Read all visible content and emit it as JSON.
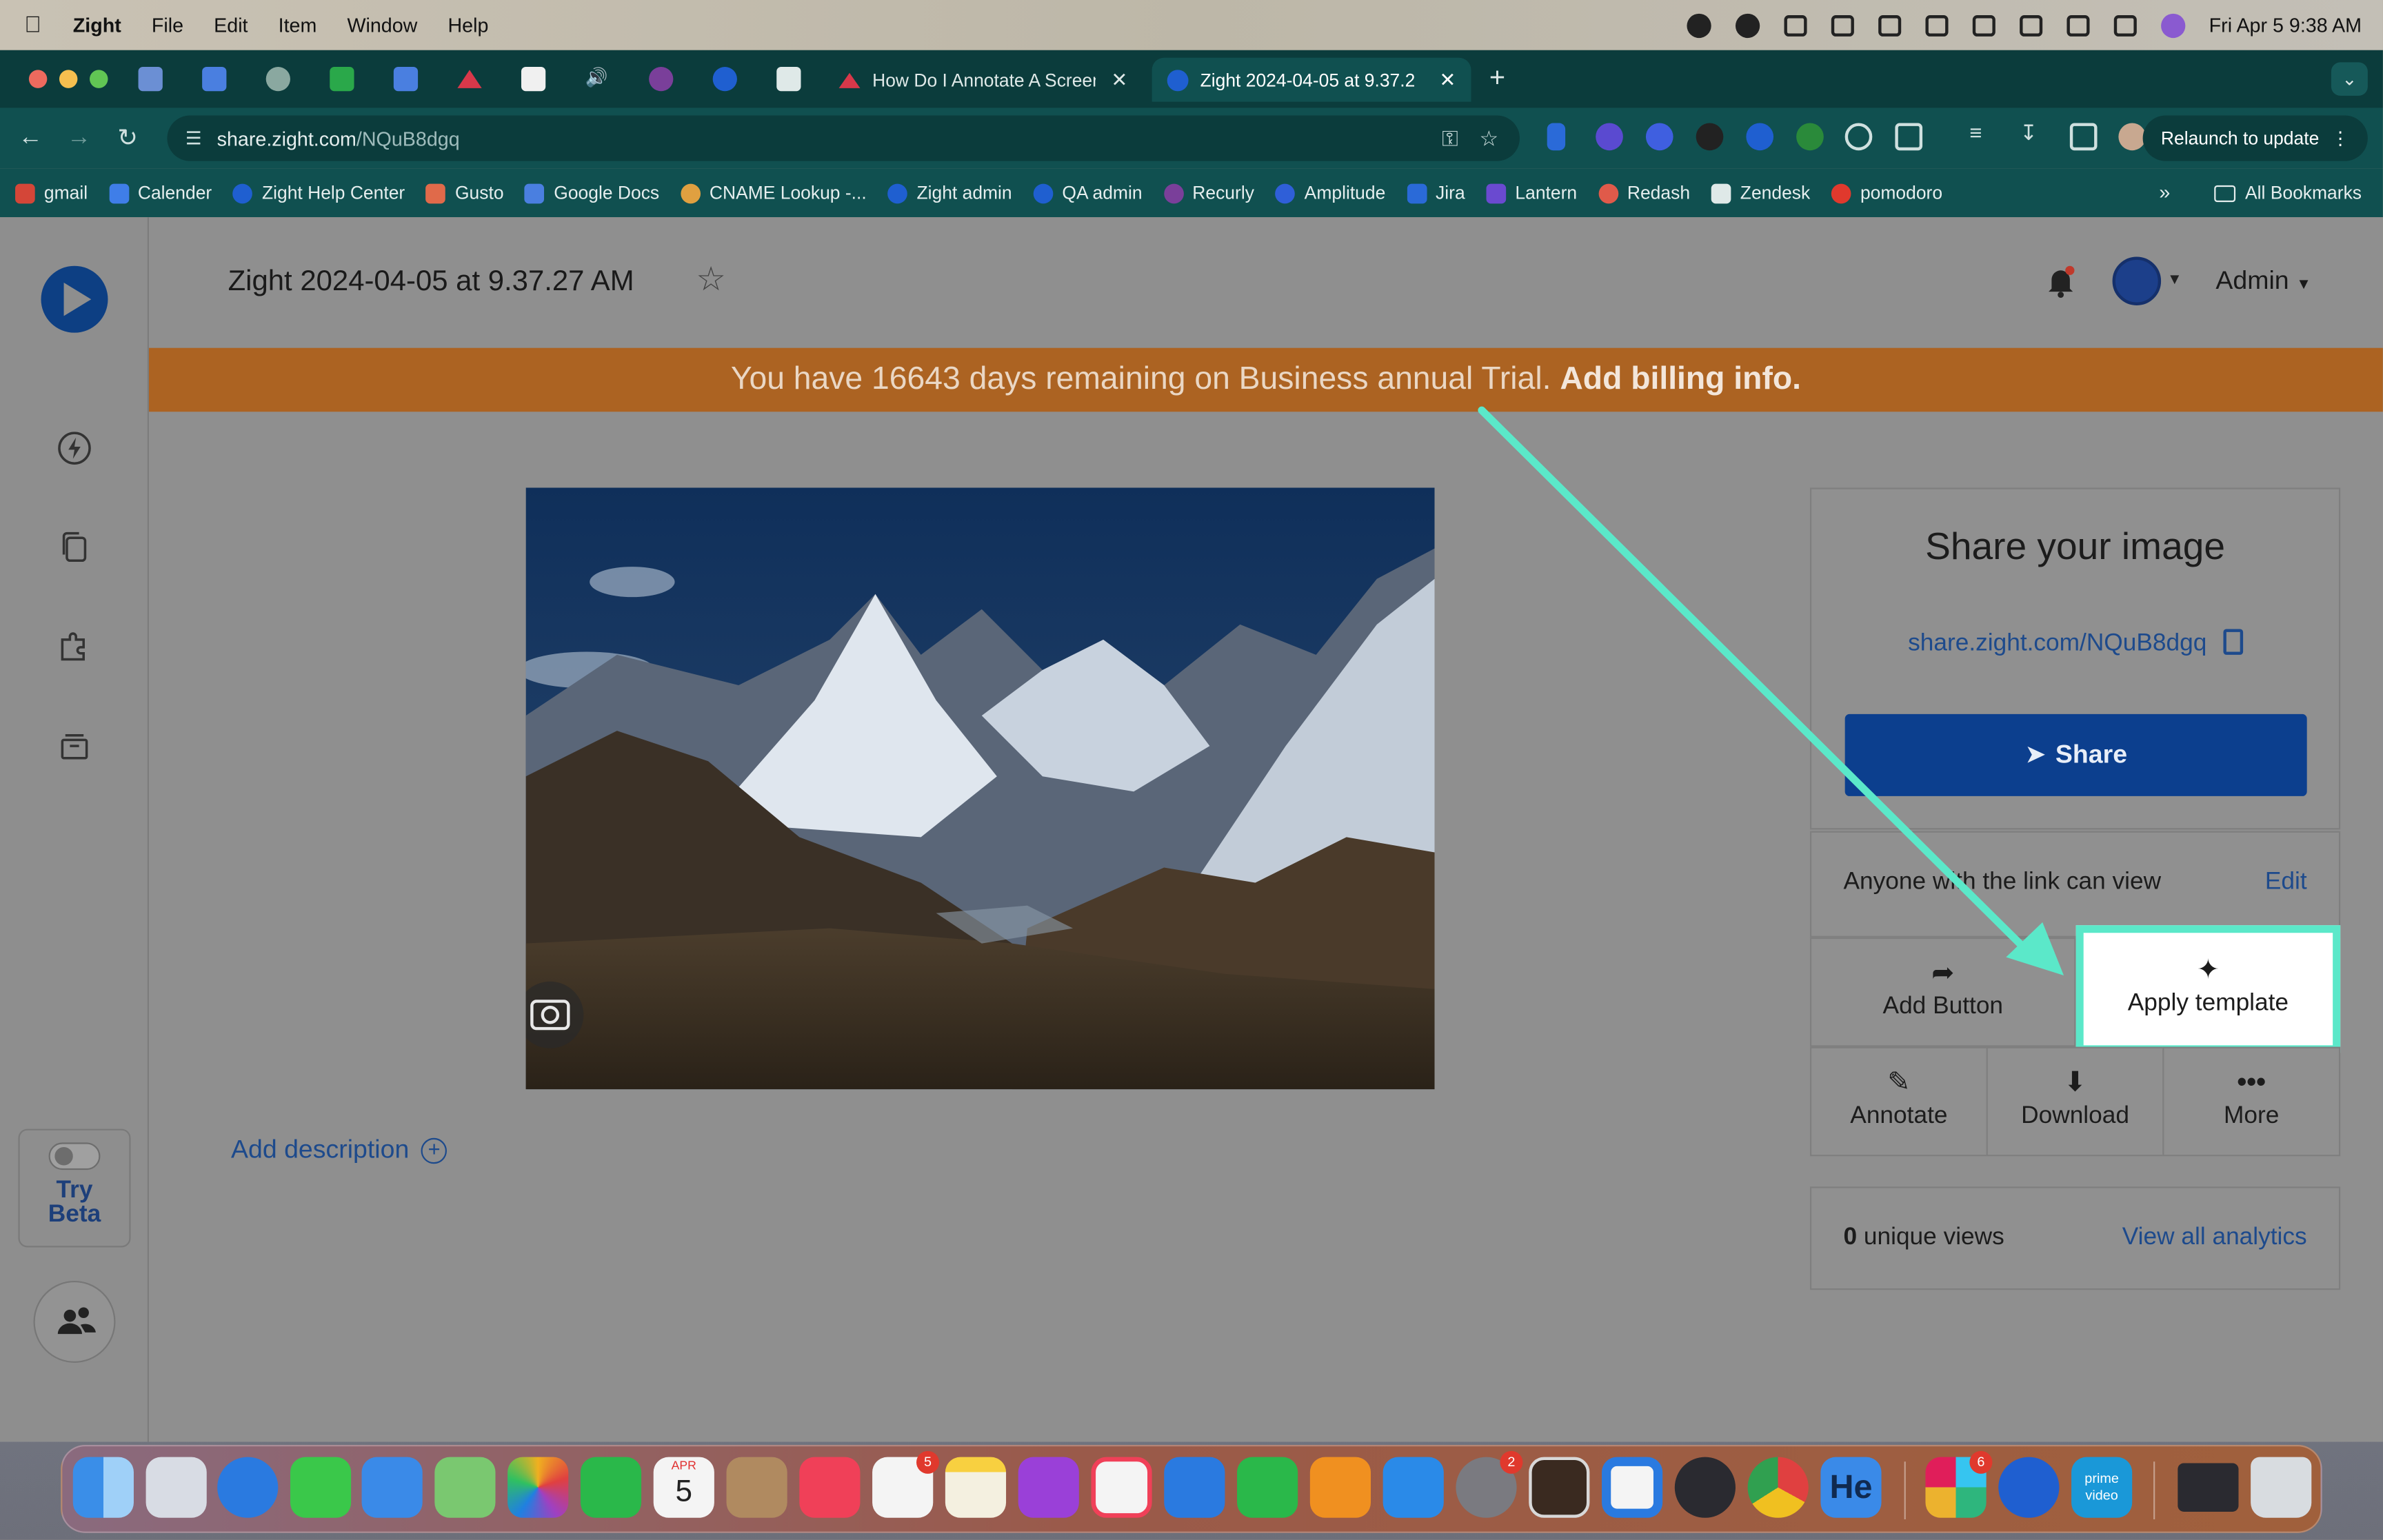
{
  "menubar": {
    "app": "Zight",
    "menus": [
      "File",
      "Edit",
      "Item",
      "Window",
      "Help"
    ],
    "datetime": "Fri Apr 5  9:38 AM"
  },
  "browser": {
    "tabs": [
      {
        "title": "How Do I Annotate A Screen",
        "close": "✕"
      },
      {
        "title": "Zight 2024-04-05 at 9.37.2",
        "close": "✕"
      }
    ],
    "new_tab": "+",
    "url_host": "share.zight.com",
    "url_path": "/NQuB8dgq",
    "relaunch": "Relaunch to update",
    "bookmarks": [
      "gmail",
      "Calender",
      "Zight Help Center",
      "Gusto",
      "Google Docs",
      "CNAME Lookup -...",
      "Zight admin",
      "QA admin",
      "Recurly",
      "Amplitude",
      "Jira",
      "Lantern",
      "Redash",
      "Zendesk",
      "pomodoro"
    ],
    "bookmarks_more": "»",
    "all_bookmarks": "All Bookmarks"
  },
  "page": {
    "title": "Zight 2024-04-05 at 9.37.27 AM",
    "account_label": "Admin",
    "banner_text": "You have 16643 days remaining on Business annual Trial.",
    "banner_link": "Add billing info.",
    "add_description": "Add description",
    "try_beta_1": "Try",
    "try_beta_2": "Beta"
  },
  "share_panel": {
    "heading": "Share your image",
    "link": "share.zight.com/NQuB8dgq",
    "share_button": "Share",
    "permission": "Anyone with the link can view",
    "edit": "Edit",
    "actions": {
      "add_button": "Add Button",
      "apply_template": "Apply template",
      "annotate": "Annotate",
      "download": "Download",
      "more": "More"
    },
    "views_count": "0",
    "views_label": " unique views",
    "analytics_link": "View all analytics"
  },
  "dock": {
    "calendar_month": "APR",
    "calendar_day": "5",
    "badges": {
      "reminders": "5",
      "settings": "2",
      "slack": "6"
    },
    "he_label": "He",
    "prime_label": "prime video"
  },
  "colors": {
    "accent": "#0c3f8e",
    "banner": "#ac6322",
    "highlight": "#5be8c9"
  }
}
